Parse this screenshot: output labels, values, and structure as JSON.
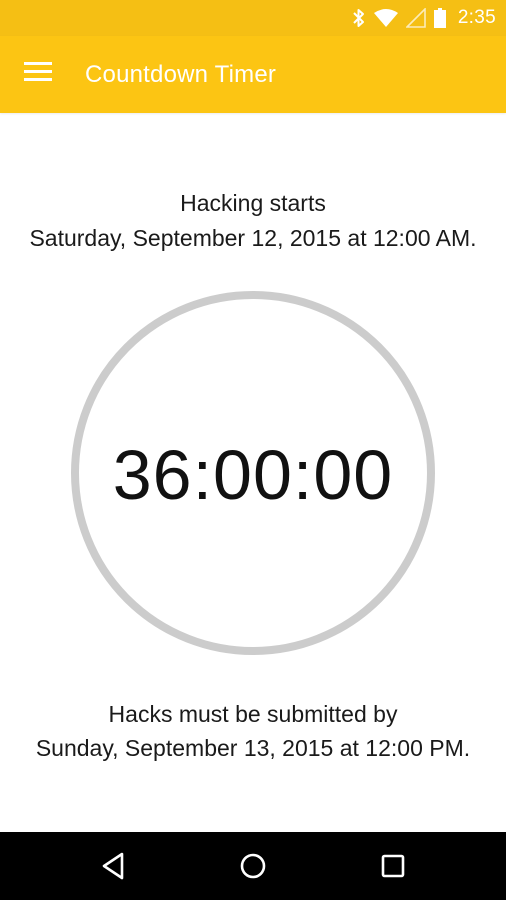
{
  "status_bar": {
    "time": "2:35",
    "icons": [
      "bluetooth-icon",
      "wifi-icon",
      "cell-signal-icon",
      "battery-icon"
    ]
  },
  "app_bar": {
    "title": "Countdown Timer",
    "menu_icon": "hamburger-menu-icon",
    "color": "#fcc513"
  },
  "start": {
    "label": "Hacking starts",
    "datetime": "Saturday, September 12, 2015 at 12:00 AM."
  },
  "timer": {
    "value": "36:00:00",
    "ring_color": "#cccccc"
  },
  "end": {
    "label": "Hacks must be submitted by",
    "datetime": "Sunday, September 13, 2015 at 12:00 PM."
  },
  "nav_bar": {
    "buttons": [
      "back-icon",
      "home-icon",
      "recents-icon"
    ]
  }
}
